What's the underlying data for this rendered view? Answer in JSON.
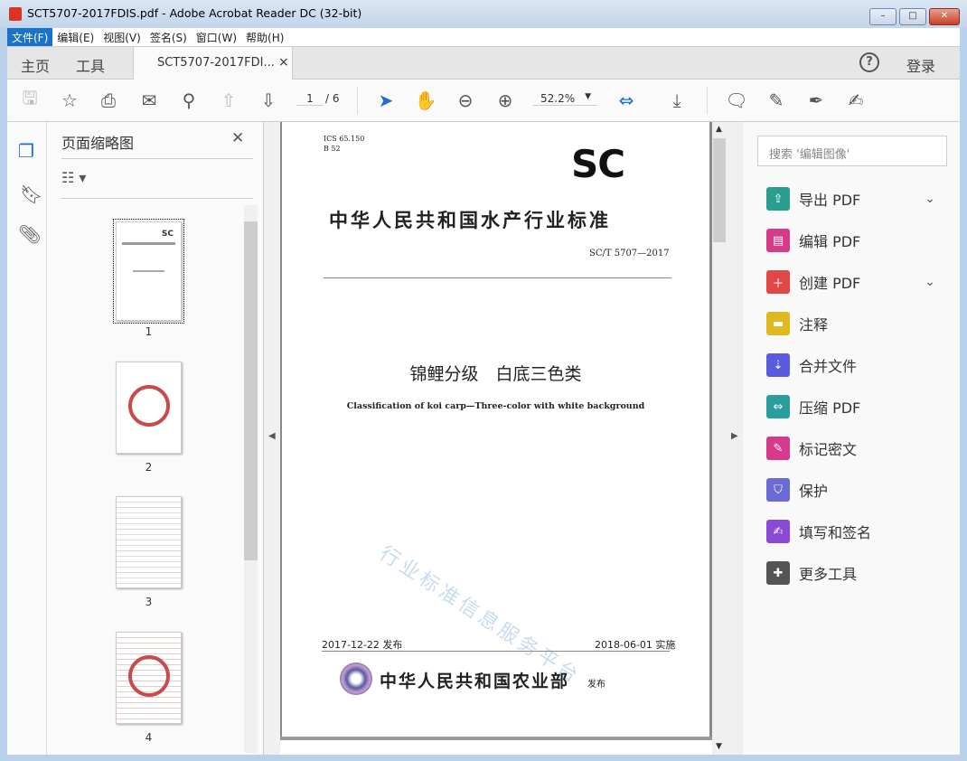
{
  "window": {
    "title": "SCT5707-2017FDIS.pdf - Adobe Acrobat Reader DC (32-bit)",
    "min": "–",
    "max": "□",
    "close": "✕"
  },
  "menu": [
    "文件(F)",
    "编辑(E)",
    "视图(V)",
    "签名(S)",
    "窗口(W)",
    "帮助(H)"
  ],
  "tabs": {
    "home": "主页",
    "tools": "工具",
    "doc": "SCT5707-2017FDI...",
    "close": "×",
    "help": "?",
    "login": "登录"
  },
  "toolbar": {
    "page_current": "1",
    "page_total": "/ 6",
    "zoom": "52.2%"
  },
  "thumbs": {
    "title": "页面缩略图",
    "close": "✕",
    "pages": [
      "1",
      "2",
      "3",
      "4"
    ]
  },
  "page": {
    "ics": "ICS 65.150",
    "b": "B 52",
    "logo": "SC",
    "org_title": "中华人民共和国水产行业标准",
    "code": "SC/T 5707—2017",
    "title_cn": "锦鲤分级　白底三色类",
    "title_en": "Classification of koi carp—Three-color with white background",
    "watermark": "行业标准信息服务平台",
    "issue": "2017-12-22 发布",
    "impl": "2018-06-01 实施",
    "issuer": "中华人民共和国农业部",
    "issuer_suffix": "发布"
  },
  "tools": {
    "search_placeholder": "搜索 '编辑图像'",
    "items": [
      {
        "label": "导出 PDF",
        "color": "#2a9d8f",
        "chev": true
      },
      {
        "label": "编辑 PDF",
        "color": "#d63a8a"
      },
      {
        "label": "创建 PDF",
        "color": "#e04848",
        "chev": true
      },
      {
        "label": "注释",
        "color": "#e0b820"
      },
      {
        "label": "合并文件",
        "color": "#5b5be0"
      },
      {
        "label": "压缩 PDF",
        "color": "#2a9d9d"
      },
      {
        "label": "标记密文",
        "color": "#d63a8a"
      },
      {
        "label": "保护",
        "color": "#6b6bd6"
      },
      {
        "label": "填写和签名",
        "color": "#8a4ad6"
      },
      {
        "label": "更多工具",
        "color": "#555555"
      }
    ]
  }
}
